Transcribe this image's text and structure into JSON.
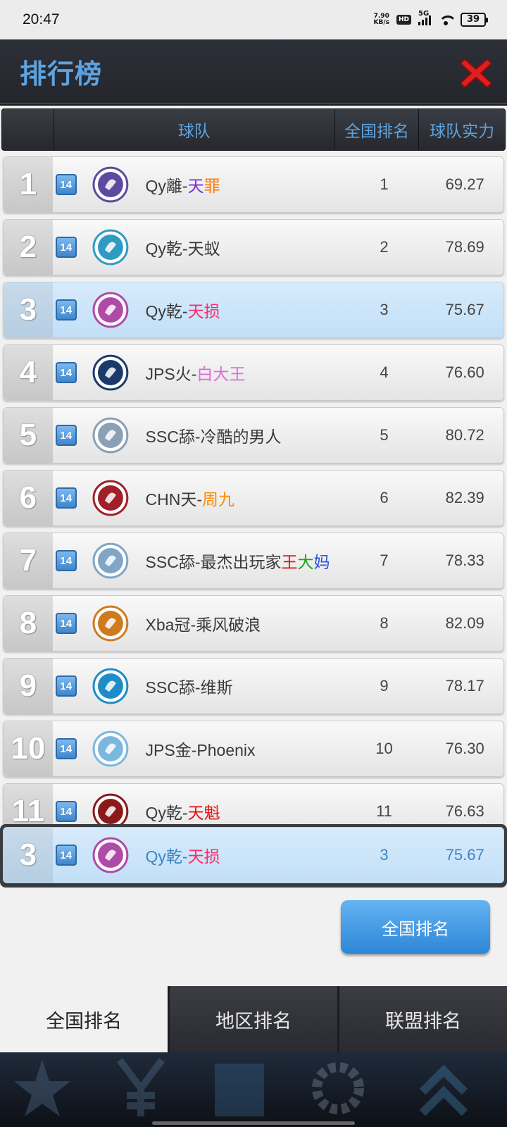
{
  "status_bar": {
    "time": "20:47",
    "net_speed_value": "7.90",
    "net_speed_unit": "KB/s",
    "hd": "HD",
    "network": "5G",
    "battery": "39"
  },
  "header": {
    "title": "排行榜"
  },
  "table": {
    "columns": {
      "team": "球队",
      "national_rank": "全国排名",
      "power": "球队实力"
    },
    "rows": [
      {
        "rank": "1",
        "level": "14",
        "prefix": "Qy離-",
        "name_parts": [
          {
            "t": "天",
            "c": "#7a2bd6"
          },
          {
            "t": "罪",
            "c": "#ff7a00"
          }
        ],
        "national_rank": "1",
        "power": "69.27",
        "logo_color": "#5b4aa0"
      },
      {
        "rank": "2",
        "level": "14",
        "prefix": "Qy乾-",
        "name_parts": [
          {
            "t": "天蚁",
            "c": "#3a3a3a"
          }
        ],
        "national_rank": "2",
        "power": "78.69",
        "logo_color": "#2f9bc4"
      },
      {
        "rank": "3",
        "level": "14",
        "prefix": "Qy乾-",
        "name_parts": [
          {
            "t": "天损",
            "c": "#ff2a6a"
          }
        ],
        "national_rank": "3",
        "power": "75.67",
        "logo_color": "#b04aa8",
        "highlight": true
      },
      {
        "rank": "4",
        "level": "14",
        "prefix": "JPS火-",
        "name_parts": [
          {
            "t": "白大王",
            "c": "#e06ad8"
          }
        ],
        "national_rank": "4",
        "power": "76.60",
        "logo_color": "#1b3a6b"
      },
      {
        "rank": "5",
        "level": "14",
        "prefix": "SSC舔-",
        "name_parts": [
          {
            "t": "冷酷的男人",
            "c": "#3a3a3a"
          }
        ],
        "national_rank": "5",
        "power": "80.72",
        "logo_color": "#8aa0b4"
      },
      {
        "rank": "6",
        "level": "14",
        "prefix": "CHN天-",
        "name_parts": [
          {
            "t": "周九",
            "c": "#ff8a00"
          }
        ],
        "national_rank": "6",
        "power": "82.39",
        "logo_color": "#a0202a"
      },
      {
        "rank": "7",
        "level": "14",
        "prefix": "SSC舔-",
        "name_parts": [
          {
            "t": "最杰出玩家",
            "c": "#3a3a3a"
          },
          {
            "t": "王",
            "c": "#e81010"
          },
          {
            "t": "大",
            "c": "#1aa81a"
          },
          {
            "t": "妈",
            "c": "#2a50e0"
          }
        ],
        "national_rank": "7",
        "power": "78.33",
        "logo_color": "#7fa6c6"
      },
      {
        "rank": "8",
        "level": "14",
        "prefix": "Xba冠-",
        "name_parts": [
          {
            "t": "乘风破浪",
            "c": "#3a3a3a"
          }
        ],
        "national_rank": "8",
        "power": "82.09",
        "logo_color": "#d07a20"
      },
      {
        "rank": "9",
        "level": "14",
        "prefix": "SSC舔-",
        "name_parts": [
          {
            "t": "维斯",
            "c": "#3a3a3a"
          }
        ],
        "national_rank": "9",
        "power": "78.17",
        "logo_color": "#1e8cc8"
      },
      {
        "rank": "10",
        "level": "14",
        "prefix": "JPS金-",
        "name_parts": [
          {
            "t": "Phoenix",
            "c": "#3a3a3a"
          }
        ],
        "national_rank": "10",
        "power": "76.30",
        "logo_color": "#7ab8e0"
      },
      {
        "rank": "11",
        "level": "14",
        "prefix": "Qy乾-",
        "name_parts": [
          {
            "t": "天魁",
            "c": "#e81010"
          }
        ],
        "national_rank": "11",
        "power": "76.63",
        "logo_color": "#8a1a1a"
      }
    ],
    "self_row": {
      "rank": "3",
      "level": "14",
      "prefix": "Qy乾-",
      "name_parts": [
        {
          "t": "天损",
          "c": "#ff2a6a"
        }
      ],
      "national_rank": "3",
      "power": "75.67",
      "logo_color": "#b04aa8"
    }
  },
  "national_rank_button": "全国排名",
  "tabs": [
    {
      "label": "全国排名",
      "active": true
    },
    {
      "label": "地区排名",
      "active": false
    },
    {
      "label": "联盟排名",
      "active": false
    }
  ],
  "colors": {
    "accent": "#5da3e0",
    "highlight": "#c9e3f8",
    "button": "#3a92dc",
    "close": "#e02020"
  }
}
